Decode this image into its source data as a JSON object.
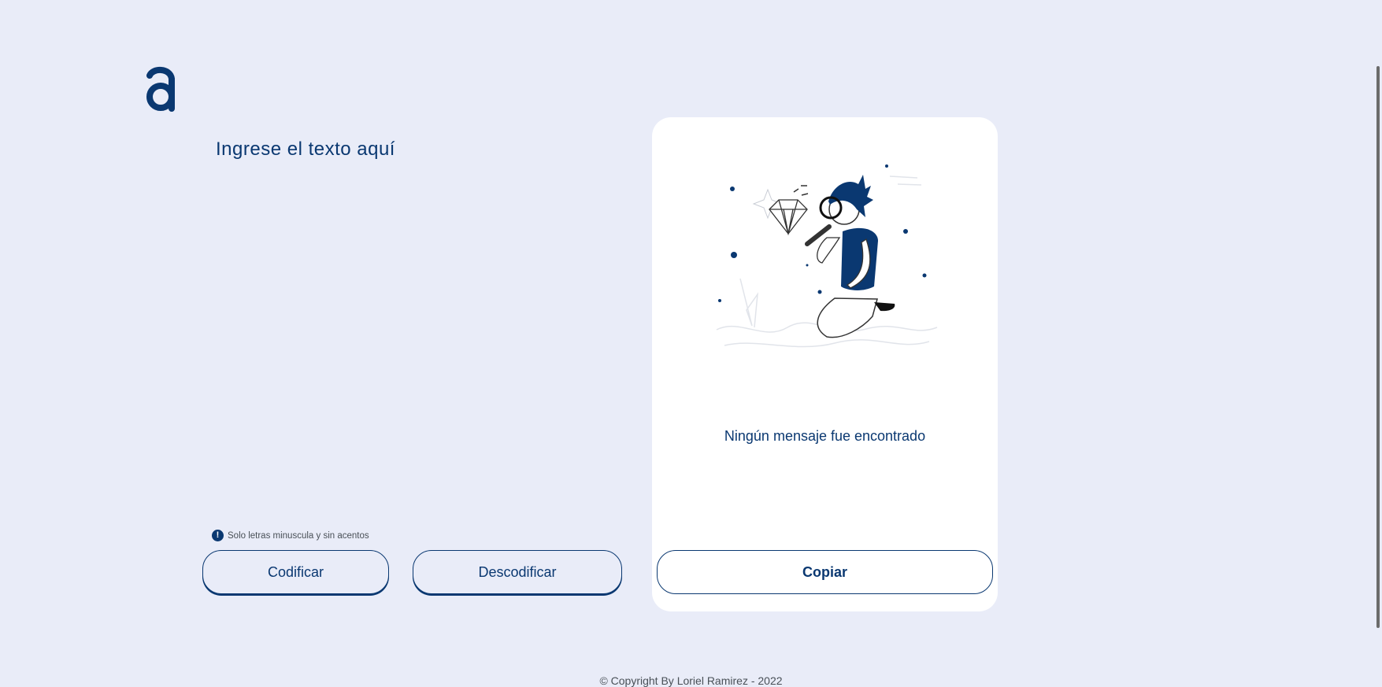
{
  "brand": {
    "logo_letter": "a",
    "logo_alt": "Alura logo",
    "color": "#0a3871"
  },
  "editor": {
    "placeholder": "Ingrese el texto aquí"
  },
  "hint": {
    "icon": "info-icon",
    "icon_glyph": "!",
    "text": "Solo letras minuscula y sin acentos"
  },
  "actions": {
    "encode_label": "Codificar",
    "decode_label": "Descodificar"
  },
  "output": {
    "illustration": "person-with-magnifying-glass-illustration",
    "empty_title": "Ningún mensaje fue encontrado",
    "copy_label": "Copiar"
  },
  "footer": {
    "text": "© Copyright By Loriel Ramirez - 2022"
  },
  "colors": {
    "background": "#e9ecf8",
    "primary": "#0a3871",
    "card": "#ffffff"
  }
}
